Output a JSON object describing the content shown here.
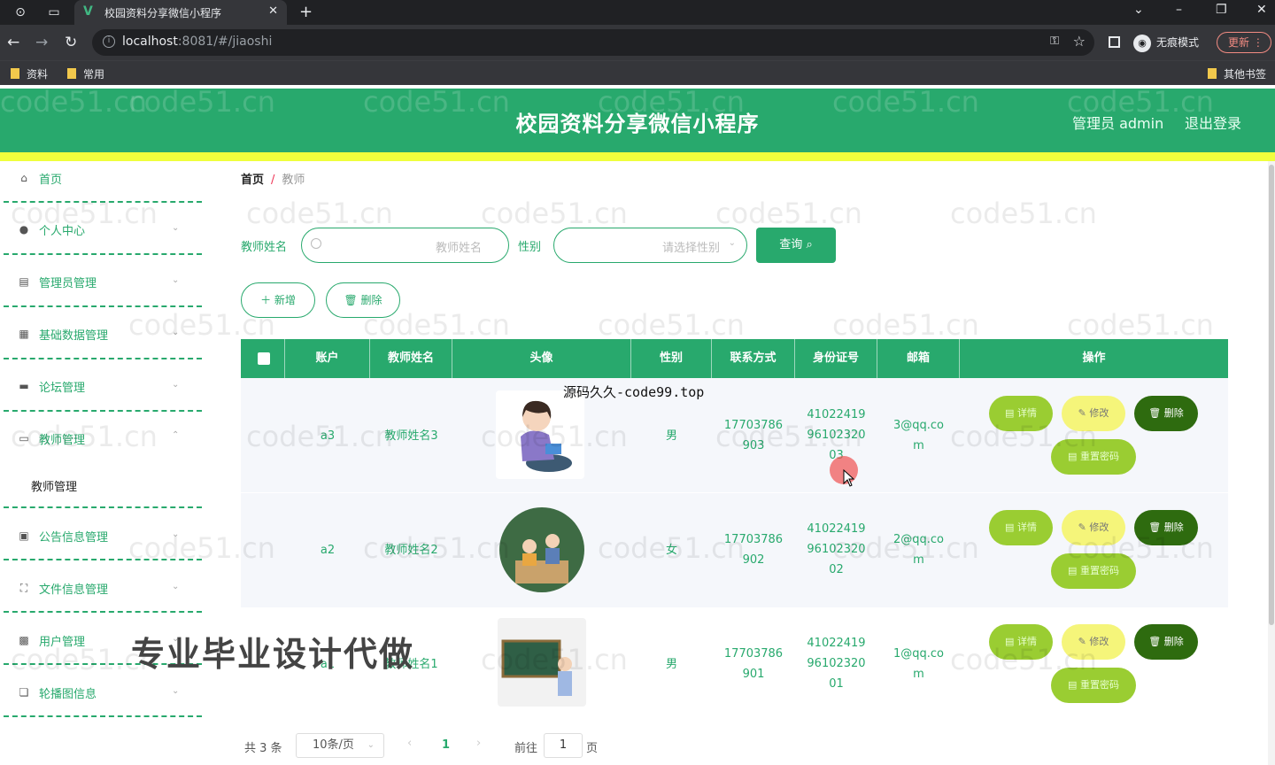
{
  "browser": {
    "tab_title": "校园资料分享微信小程序",
    "url_host": "localhost",
    "url_rest": ":8081/#/jiaoshi",
    "incognito_label": "无痕模式",
    "update_label": "更新",
    "bookmarks": [
      "资料",
      "常用"
    ],
    "other_bookmarks": "其他书签"
  },
  "header": {
    "title": "校园资料分享微信小程序",
    "user": "管理员 admin",
    "logout": "退出登录"
  },
  "sidebar": {
    "items": [
      {
        "label": "首页",
        "icon": "home-icon"
      },
      {
        "label": "个人中心",
        "icon": "user-icon"
      },
      {
        "label": "管理员管理",
        "icon": "document-icon"
      },
      {
        "label": "基础数据管理",
        "icon": "chat-icon"
      },
      {
        "label": "论坛管理",
        "icon": "monitor-icon"
      },
      {
        "label": "教师管理",
        "icon": "card-icon"
      },
      {
        "label": "公告信息管理",
        "icon": "clipboard-icon"
      },
      {
        "label": "文件信息管理",
        "icon": "frame-icon"
      },
      {
        "label": "用户管理",
        "icon": "grid-icon"
      },
      {
        "label": "轮播图信息",
        "icon": "copy-icon"
      }
    ],
    "sub_item": "教师管理"
  },
  "breadcrumb": {
    "home": "首页",
    "sep": "/",
    "current": "教师"
  },
  "filters": {
    "name_label": "教师姓名",
    "name_placeholder": "教师姓名",
    "gender_label": "性别",
    "gender_placeholder": "请选择性别",
    "query_label": "查询"
  },
  "toolbar": {
    "add_label": "新增",
    "delete_label": "删除"
  },
  "table": {
    "headers": [
      "账户",
      "教师姓名",
      "头像",
      "性别",
      "联系方式",
      "身份证号",
      "邮箱",
      "操作"
    ],
    "rows": [
      {
        "account": "a3",
        "name": "教师姓名3",
        "gender": "男",
        "phone1": "17703786",
        "phone2": "903",
        "id1": "41022419",
        "id2": "96102320",
        "id3": "03",
        "email1": "3@qq.co",
        "email2": "m"
      },
      {
        "account": "a2",
        "name": "教师姓名2",
        "gender": "女",
        "phone1": "17703786",
        "phone2": "902",
        "id1": "41022419",
        "id2": "96102320",
        "id3": "02",
        "email1": "2@qq.co",
        "email2": "m"
      },
      {
        "account": "a1",
        "name": "教师姓名1",
        "gender": "男",
        "phone1": "17703786",
        "phone2": "901",
        "id1": "41022419",
        "id2": "96102320",
        "id3": "01",
        "email1": "1@qq.co",
        "email2": "m"
      }
    ],
    "actions": {
      "detail": "详情",
      "edit": "修改",
      "delete": "删除",
      "reset": "重置密码"
    }
  },
  "pagination": {
    "total": "共 3 条",
    "page_size": "10条/页",
    "current_page": "1",
    "goto_label": "前往",
    "goto_value": "1",
    "page_suffix": "页"
  },
  "overlays": {
    "source_text": "源码久久-code99.top",
    "promo_text": "专业毕业设计代做",
    "watermark": "code51.cn"
  },
  "colors": {
    "primary": "#28a96d",
    "accent_yellow": "#f0ff3c",
    "delete_dark": "#2e6b0f",
    "detail_green": "#9acd32",
    "edit_yellow": "#f5f57a"
  }
}
